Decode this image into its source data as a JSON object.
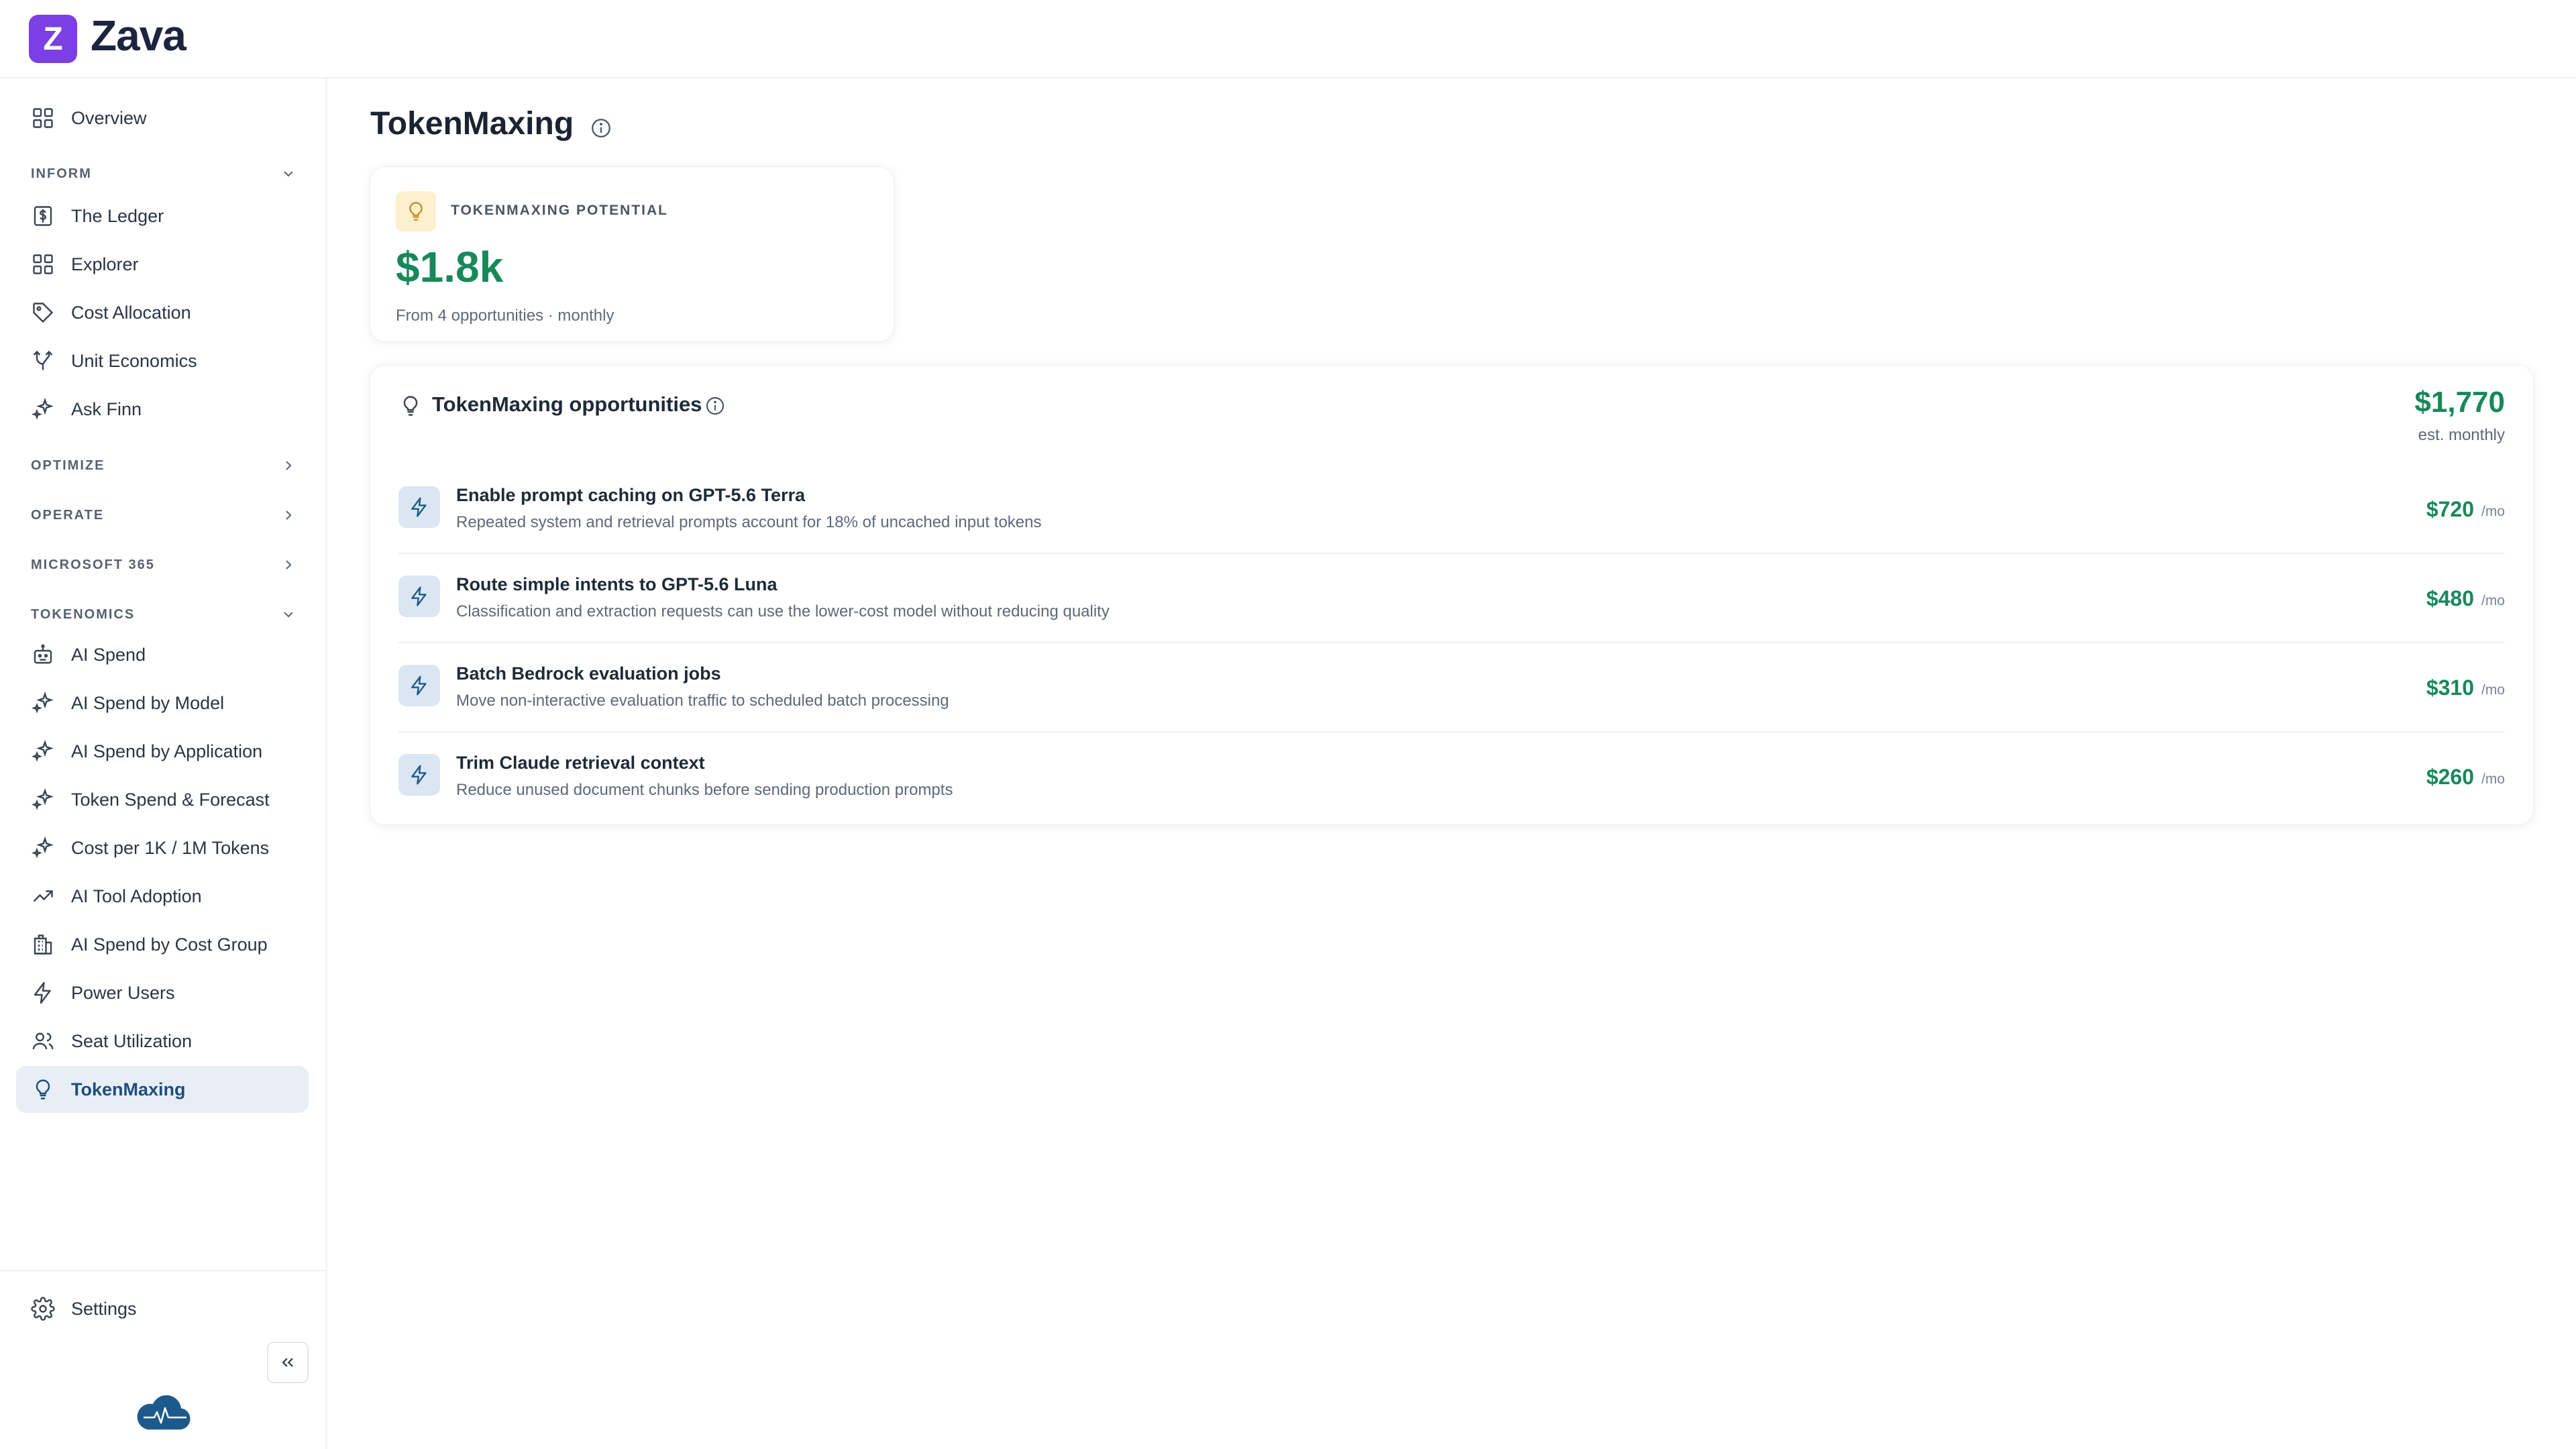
{
  "app": {
    "logo_letter": "Z",
    "name": "Zava"
  },
  "sidebar": {
    "overview": "Overview",
    "sections": {
      "inform": "INFORM",
      "optimize": "OPTIMIZE",
      "operate": "OPERATE",
      "microsoft365": "MICROSOFT 365",
      "tokenomics": "TOKENOMICS"
    },
    "inform_items": [
      "The Ledger",
      "Explorer",
      "Cost Allocation",
      "Unit Economics",
      "Ask Finn"
    ],
    "tokenomics_items": [
      "AI Spend",
      "AI Spend by Model",
      "AI Spend by Application",
      "Token Spend & Forecast",
      "Cost per 1K / 1M Tokens",
      "AI Tool Adoption",
      "AI Spend by Cost Group",
      "Power Users",
      "Seat Utilization",
      "TokenMaxing"
    ],
    "active_item": "TokenMaxing",
    "settings": "Settings"
  },
  "page": {
    "title": "TokenMaxing"
  },
  "kpi": {
    "label": "TOKENMAXING POTENTIAL",
    "value": "$1.8k",
    "subtitle": "From 4 opportunities · monthly"
  },
  "opportunities": {
    "title": "TokenMaxing opportunities",
    "total": "$1,770",
    "total_sub": "est. monthly",
    "unit": "/mo",
    "items": [
      {
        "title": "Enable prompt caching on GPT-5.6 Terra",
        "desc": "Repeated system and retrieval prompts account for 18% of uncached input tokens",
        "amount": "$720"
      },
      {
        "title": "Route simple intents to GPT-5.6 Luna",
        "desc": "Classification and extraction requests can use the lower-cost model without reducing quality",
        "amount": "$480"
      },
      {
        "title": "Batch Bedrock evaluation jobs",
        "desc": "Move non-interactive evaluation traffic to scheduled batch processing",
        "amount": "$310"
      },
      {
        "title": "Trim Claude retrieval context",
        "desc": "Reduce unused document chunks before sending production prompts",
        "amount": "$260"
      }
    ]
  },
  "colors": {
    "brand": "#7b3fe4",
    "positive": "#17885a",
    "active_bg": "#e8eef6",
    "bulb_bg": "#fdf0cf",
    "bolt_bg": "#dbe6f3"
  },
  "icons": {
    "overview": "grid-icon",
    "ledger": "dollar-document-icon",
    "explorer": "grid-icon",
    "cost_allocation": "tag-icon",
    "unit_economics": "fork-icon",
    "ask_finn": "sparkle-icon",
    "ai_spend": "robot-icon",
    "ai_tool_adoption": "trending-up-icon",
    "cost_group": "building-icon",
    "power_users": "bolt-icon",
    "seat_utilization": "users-icon",
    "tokenmaxing": "lightbulb-icon",
    "settings": "gear-icon",
    "collapse": "double-chevron-left-icon",
    "footer_logo": "cloud-pulse-icon"
  }
}
